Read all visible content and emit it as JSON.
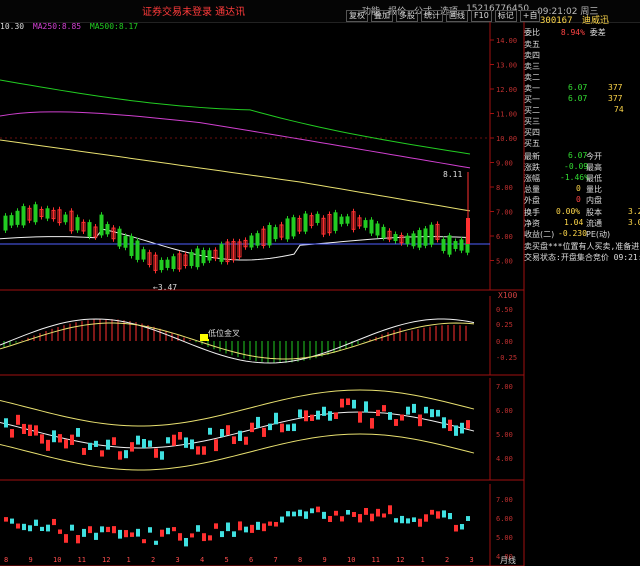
{
  "window": {
    "title": "证券交易未登录  通达讯",
    "menu": [
      "功能",
      "报价",
      "公式",
      "选项"
    ],
    "phone": "15216776450",
    "datetime": "09:21:02 周三"
  },
  "toolbar": {
    "buttons": [
      "复权",
      "叠加",
      "多股",
      "统计",
      "画线",
      "F10",
      "标记",
      "+自"
    ]
  },
  "stock": {
    "code": "300167",
    "name": "迪威迅"
  },
  "ma_line": {
    "ma1": "10.30",
    "ma250": "MA250:8.85",
    "ma500": "MA500:8.17"
  },
  "price_axis": [
    "14.00",
    "13.00",
    "12.00",
    "11.00",
    "10.00",
    "9.00",
    "8.00",
    "7.00",
    "6.00",
    "5.00"
  ],
  "annotations": {
    "high": "8.11",
    "low": "3.47",
    "signal": "低位金叉",
    "macd_label": "X100"
  },
  "macd_axis": [
    "0.50",
    "0.25",
    "0.00",
    "-0.25"
  ],
  "kdj_axis": [
    "7.00",
    "6.00",
    "5.00",
    "4.00"
  ],
  "sub_axis": [
    "7.00",
    "6.00",
    "5.00",
    "4.00"
  ],
  "x_axis": [
    "8",
    "9",
    "10",
    "11",
    "12",
    "1",
    "2",
    "3",
    "4",
    "5",
    "6",
    "7",
    "8",
    "9",
    "10",
    "11",
    "12",
    "1",
    "2",
    "3"
  ],
  "x_unit": "月线",
  "quote": {
    "weibi": "委比",
    "weibi_val": "8.94%",
    "weicha": "委差",
    "sell5": "卖五",
    "sell4": "卖四",
    "sell3": "卖三",
    "sell2": "卖二",
    "sell1": "卖一",
    "sell1_price": "6.07",
    "sell1_vol": "377",
    "buy1": "买一",
    "buy1_price": "6.07",
    "buy1_vol": "377",
    "buy2": "买二",
    "buy2_vol": "74",
    "buy3": "买三",
    "buy4": "买四",
    "buy5": "买五",
    "latest": "最新",
    "latest_val": "6.07",
    "open": "今开",
    "change": "涨跌",
    "change_val": "-0.09",
    "high": "最高",
    "pct": "涨幅",
    "pct_val": "-1.46%",
    "low": "最低",
    "total_vol": "总量",
    "vol_val": "0",
    "vol_ratio": "量比",
    "outer": "外盘",
    "outer_val": "0",
    "inner": "内盘",
    "turnover": "换手",
    "turnover_val": "0.00%",
    "equity": "股本",
    "equity_val": "3.2",
    "netasset": "净资",
    "netasset_val": "1.04",
    "float": "流通",
    "float_val": "3.0",
    "profit": "收益(二)",
    "profit_val": "-0.230",
    "pe": "PE(动)",
    "news1": "卖买盘***位置有人买卖,准备进",
    "news2": "交易状态:开盘集合竞价 09:21:"
  },
  "colors": {
    "up": "#ff3030",
    "down": "#40e0e0",
    "ma_green": "#22cc22",
    "ma_purple": "#d040d0",
    "ma_yellow": "#e8e070"
  }
}
